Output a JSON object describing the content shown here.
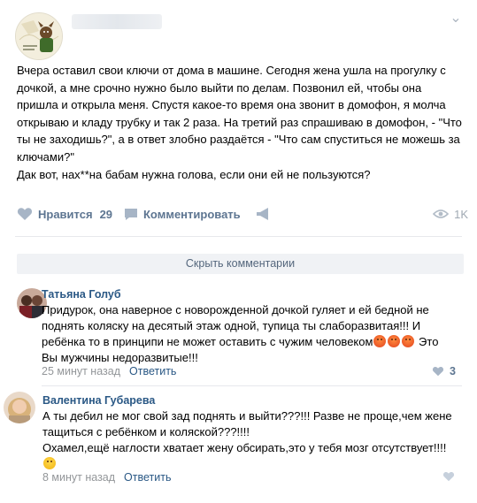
{
  "post": {
    "text": "Вчера оставил свои ключи от дома в машине. Сегодня жена ушла на прогулку с дочкой, а мне срочно нужно было выйти по делам. Позвонил ей, чтобы она пришла и открыла меня. Спустя какое-то время она звонит в домофон, я молча открываю и кладу трубку и так 2 раза. На третий раз спрашиваю в домофон, - \"Что ты не заходишь?\", а в ответ злобно раздаётся - \"Что сам спуститься не можешь за ключами?\"\nДак вот, нах**на бабам нужна голова, если они ей не пользуются?",
    "like_label": "Нравится",
    "like_count": "29",
    "comment_label": "Комментировать",
    "views": "1K"
  },
  "hide_comments_label": "Скрыть комментарии",
  "comments": [
    {
      "author": "Татьяна Голуб",
      "text_before": "Придурок, она наверное с новорожденной дочкой гуляет и ей бедной не поднять коляску на десятый этаж одной, тупица ты слаборазвитая!!! И ребёнка то в принципи не может оставить с чужим человеком",
      "text_after": " Это Вы мужчины недоразвитые!!!",
      "time": "25 минут назад",
      "reply": "Ответить",
      "likes": "3"
    },
    {
      "author": "Валентина Губарева",
      "text": "А ты дебил не мог свой зад поднять и выйти???!!! Разве не проще,чем жене тащиться с ребёнком и коляской???!!!!\nОхамел,ещё наглости хватает жену обсирать,это у тебя мозг отсутствует!!!!",
      "time": "8 минут назад",
      "reply": "Ответить"
    }
  ],
  "colors": {
    "link": "#2a5885",
    "action": "#5d7591",
    "meta": "#939699"
  }
}
